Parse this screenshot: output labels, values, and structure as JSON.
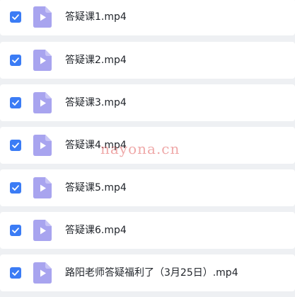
{
  "colors": {
    "accent": "#3b7cf5",
    "file_icon": "#a8a4ef",
    "background": "#eef0f3",
    "row": "#ffffff",
    "watermark": "#e26060"
  },
  "files": [
    {
      "name": "答疑课1.mp4",
      "checked": true,
      "icon": "video-file-icon"
    },
    {
      "name": "答疑课2.mp4",
      "checked": true,
      "icon": "video-file-icon"
    },
    {
      "name": "答疑课3.mp4",
      "checked": true,
      "icon": "video-file-icon"
    },
    {
      "name": "答疑课4.mp4",
      "checked": true,
      "icon": "video-file-icon"
    },
    {
      "name": "答疑课5.mp4",
      "checked": true,
      "icon": "video-file-icon"
    },
    {
      "name": "答疑课6.mp4",
      "checked": true,
      "icon": "video-file-icon"
    },
    {
      "name": "路阳老师答疑福利了（3月25日）.mp4",
      "checked": true,
      "icon": "video-file-icon"
    }
  ],
  "watermark": "nayona.cn"
}
